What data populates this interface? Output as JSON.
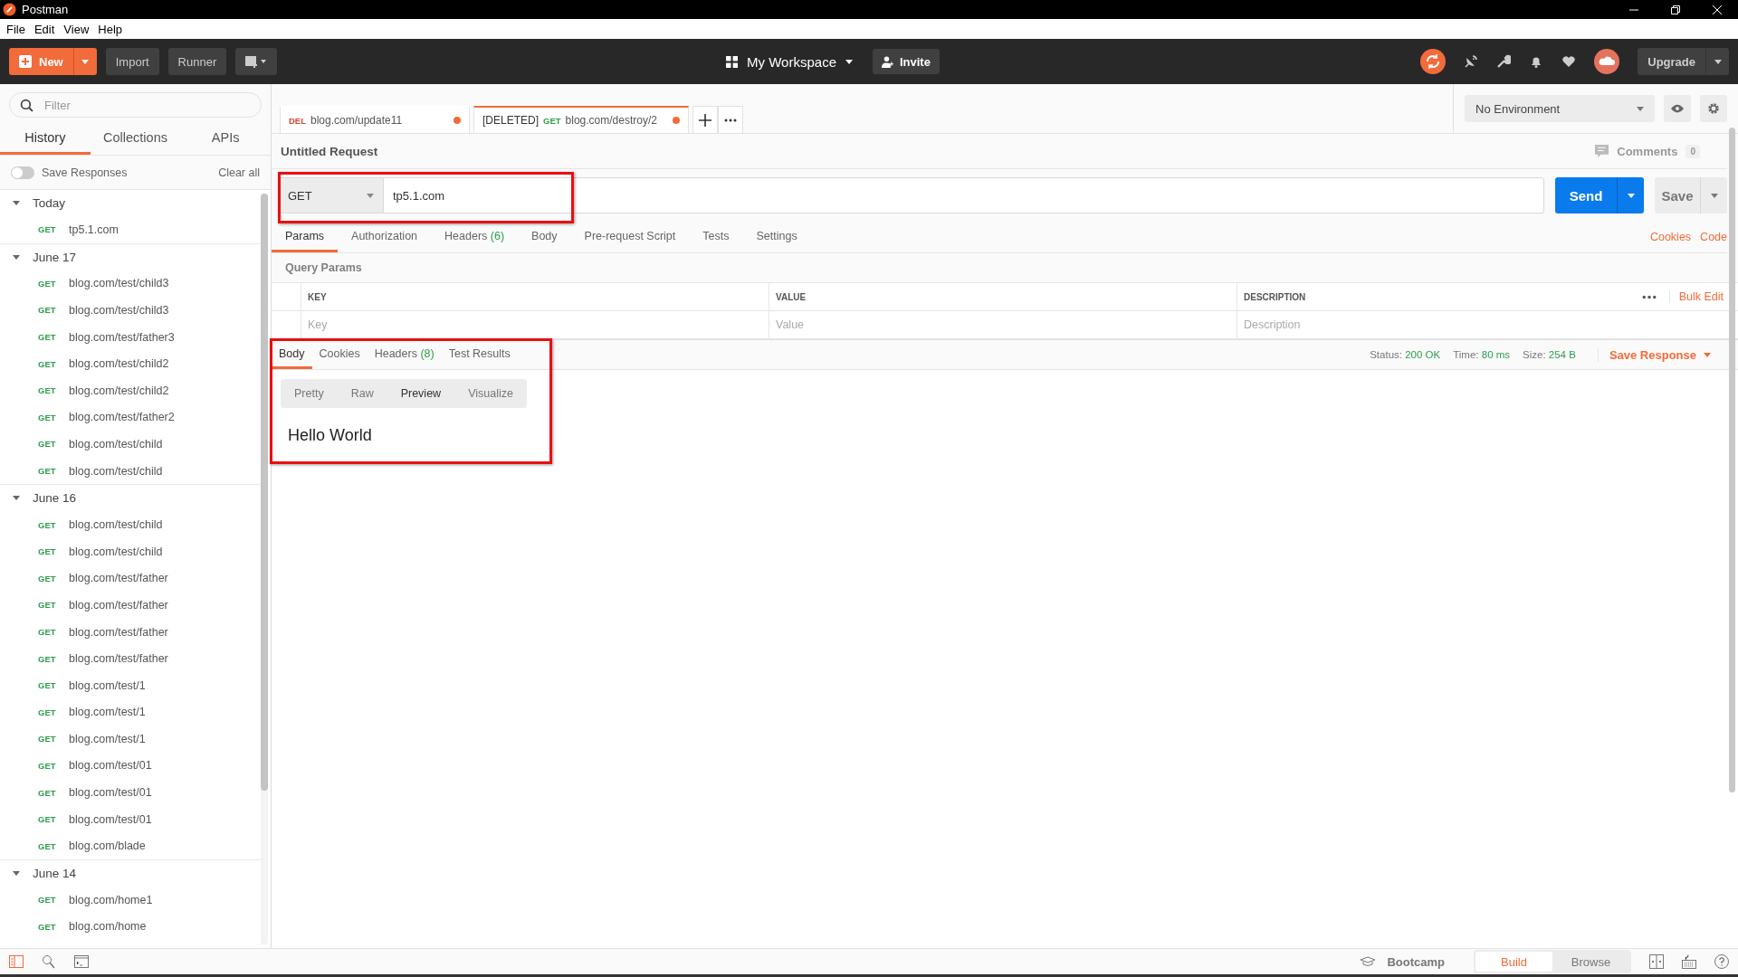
{
  "window": {
    "title": "Postman"
  },
  "menu": [
    "File",
    "Edit",
    "View",
    "Help"
  ],
  "header": {
    "new": "New",
    "import": "Import",
    "runner": "Runner",
    "workspace": "My Workspace",
    "invite": "Invite",
    "upgrade": "Upgrade"
  },
  "sidebar": {
    "filter_placeholder": "Filter",
    "tabs": [
      {
        "label": "History",
        "selected": true
      },
      {
        "label": "Collections",
        "selected": false
      },
      {
        "label": "APIs",
        "selected": false
      }
    ],
    "save_responses": {
      "label": "Save Responses",
      "on": false
    },
    "clear_all": "Clear all",
    "groups": [
      {
        "label": "Today",
        "expanded": true,
        "items": [
          {
            "method": "GET",
            "url": "tp5.1.com"
          }
        ]
      },
      {
        "label": "June 17",
        "expanded": true,
        "items": [
          {
            "method": "GET",
            "url": "blog.com/test/child3"
          },
          {
            "method": "GET",
            "url": "blog.com/test/child3"
          },
          {
            "method": "GET",
            "url": "blog.com/test/father3"
          },
          {
            "method": "GET",
            "url": "blog.com/test/child2"
          },
          {
            "method": "GET",
            "url": "blog.com/test/child2"
          },
          {
            "method": "GET",
            "url": "blog.com/test/father2"
          },
          {
            "method": "GET",
            "url": "blog.com/test/child"
          },
          {
            "method": "GET",
            "url": "blog.com/test/child"
          }
        ]
      },
      {
        "label": "June 16",
        "expanded": true,
        "items": [
          {
            "method": "GET",
            "url": "blog.com/test/child"
          },
          {
            "method": "GET",
            "url": "blog.com/test/child"
          },
          {
            "method": "GET",
            "url": "blog.com/test/father"
          },
          {
            "method": "GET",
            "url": "blog.com/test/father"
          },
          {
            "method": "GET",
            "url": "blog.com/test/father"
          },
          {
            "method": "GET",
            "url": "blog.com/test/father"
          },
          {
            "method": "GET",
            "url": "blog.com/test/1"
          },
          {
            "method": "GET",
            "url": "blog.com/test/1"
          },
          {
            "method": "GET",
            "url": "blog.com/test/1"
          },
          {
            "method": "GET",
            "url": "blog.com/test/01"
          },
          {
            "method": "GET",
            "url": "blog.com/test/01"
          },
          {
            "method": "GET",
            "url": "blog.com/test/01"
          },
          {
            "method": "GET",
            "url": "blog.com/blade"
          }
        ]
      },
      {
        "label": "June 14",
        "expanded": true,
        "items": [
          {
            "method": "GET",
            "url": "blog.com/home1"
          },
          {
            "method": "GET",
            "url": "blog.com/home"
          }
        ]
      }
    ]
  },
  "request_tabs": [
    {
      "method": "DEL",
      "color": "#e0442f",
      "url": "blog.com/update11",
      "unsaved": true,
      "selected": false
    },
    {
      "prefix": "[DELETED]",
      "method": "GET",
      "color": "#2c9e4b",
      "url": "blog.com/destroy/2",
      "unsaved": true,
      "selected": true
    }
  ],
  "environment": "No Environment",
  "request": {
    "title": "Untitled Request",
    "comments": "Comments",
    "comments_count": "0",
    "method": "GET",
    "url": "tp5.1.com",
    "send": "Send",
    "save": "Save",
    "tabs": [
      {
        "label": "Params",
        "selected": true
      },
      {
        "label": "Authorization",
        "selected": false
      },
      {
        "label": "Headers",
        "count": "(6)",
        "selected": false
      },
      {
        "label": "Body",
        "selected": false
      },
      {
        "label": "Pre-request Script",
        "selected": false
      },
      {
        "label": "Tests",
        "selected": false
      },
      {
        "label": "Settings",
        "selected": false
      }
    ],
    "links": [
      "Cookies",
      "Code"
    ]
  },
  "query_params": {
    "title": "Query Params",
    "columns": [
      "KEY",
      "VALUE",
      "DESCRIPTION"
    ],
    "placeholders": [
      "Key",
      "Value",
      "Description"
    ],
    "bulk_edit": "Bulk Edit"
  },
  "response": {
    "tabs": [
      {
        "label": "Body",
        "selected": true
      },
      {
        "label": "Cookies",
        "selected": false
      },
      {
        "label": "Headers",
        "count": "(8)",
        "selected": false
      },
      {
        "label": "Test Results",
        "selected": false
      }
    ],
    "stats": [
      {
        "label": "Status:",
        "value": "200 OK"
      },
      {
        "label": "Time:",
        "value": "80 ms"
      },
      {
        "label": "Size:",
        "value": "254 B"
      }
    ],
    "save_response": "Save Response",
    "view_modes": [
      {
        "label": "Pretty",
        "selected": false
      },
      {
        "label": "Raw",
        "selected": false
      },
      {
        "label": "Preview",
        "selected": true
      },
      {
        "label": "Visualize",
        "selected": false
      }
    ],
    "body": "Hello World"
  },
  "highlights": {
    "request_line": true,
    "response_body": true
  },
  "footer": {
    "bootcamp": "Bootcamp",
    "modes": [
      {
        "label": "Build",
        "selected": true
      },
      {
        "label": "Browse",
        "selected": false
      }
    ]
  }
}
